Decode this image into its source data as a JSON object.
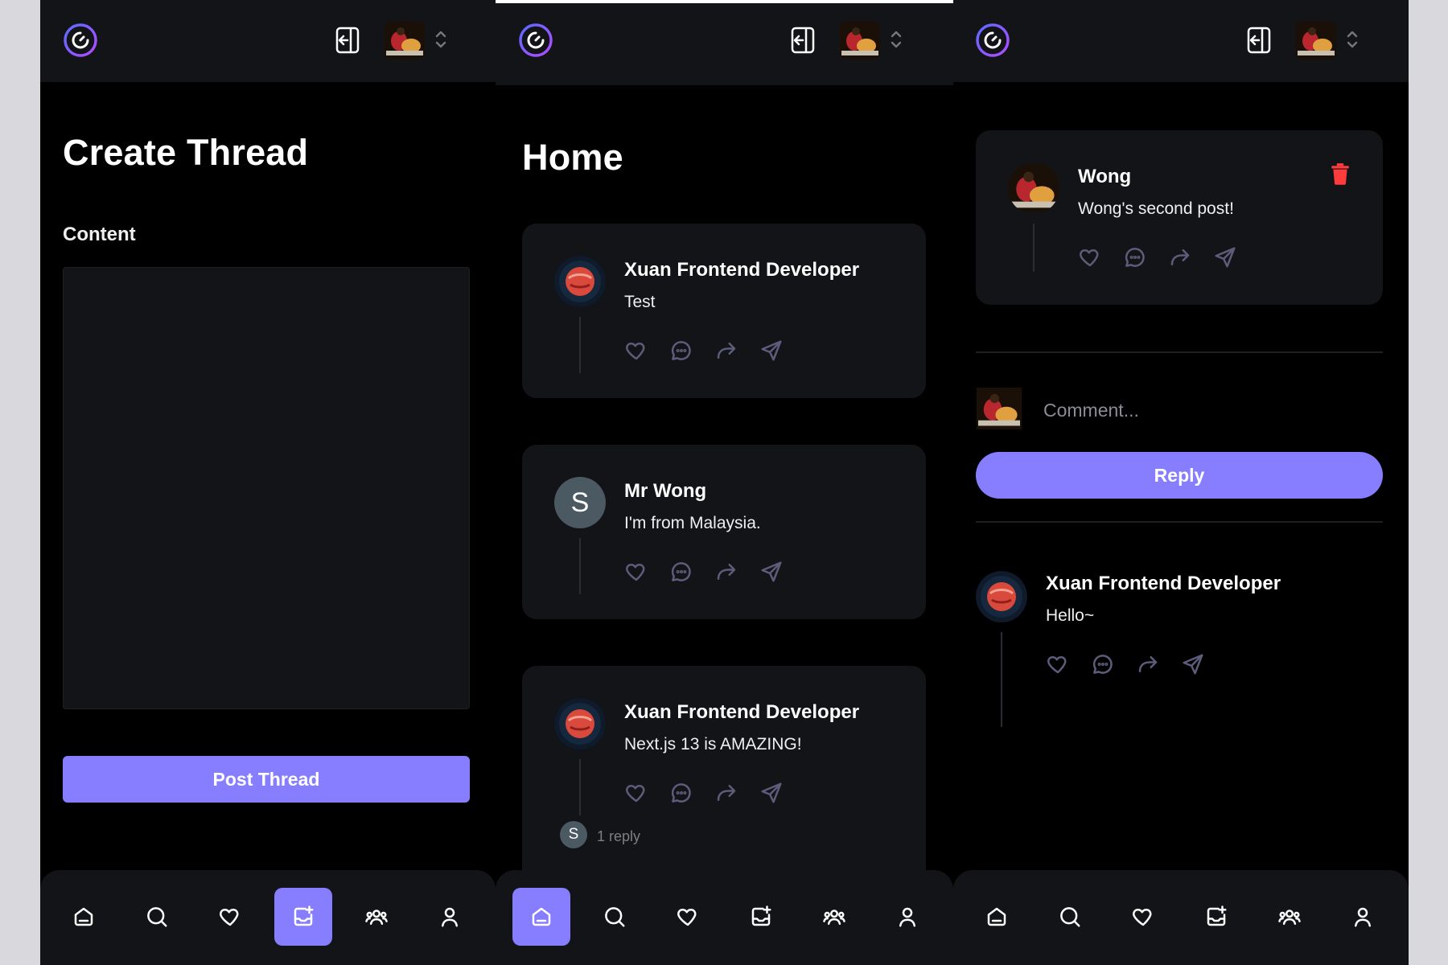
{
  "colors": {
    "primary": "#877eff",
    "card": "#121417",
    "background": "#000000",
    "icon": "#5c5c7b",
    "danger": "#ff3b3b"
  },
  "header": {
    "logo_icon": "threads-logo-icon",
    "logout_icon": "logout-icon",
    "org_switcher_icon": "chevron-up-down-icon"
  },
  "create_thread": {
    "title": "Create Thread",
    "content_label": "Content",
    "content_value": "",
    "submit_label": "Post Thread"
  },
  "home": {
    "title": "Home",
    "posts": [
      {
        "author": "Xuan Frontend Developer",
        "text": "Test"
      },
      {
        "author": "Mr Wong",
        "avatar_letter": "S",
        "text": "I'm from Malaysia."
      },
      {
        "author": "Xuan Frontend Developer",
        "text": "Next.js 13 is AMAZING!",
        "reply_avatar_letter": "S",
        "replies": "1 reply"
      }
    ]
  },
  "thread_detail": {
    "post": {
      "author": "Wong",
      "text": "Wong's second post!",
      "delete_icon": "trash-icon"
    },
    "comment_placeholder": "Comment...",
    "reply_label": "Reply",
    "comments": [
      {
        "author": "Xuan Frontend Developer",
        "text": "Hello~"
      }
    ]
  },
  "bottombar": {
    "items": [
      "home-icon",
      "search-icon",
      "heart-icon",
      "create-thread-icon",
      "community-icon",
      "profile-icon"
    ],
    "active_by_panel": [
      "create-thread-icon",
      "home-icon",
      "none"
    ]
  }
}
